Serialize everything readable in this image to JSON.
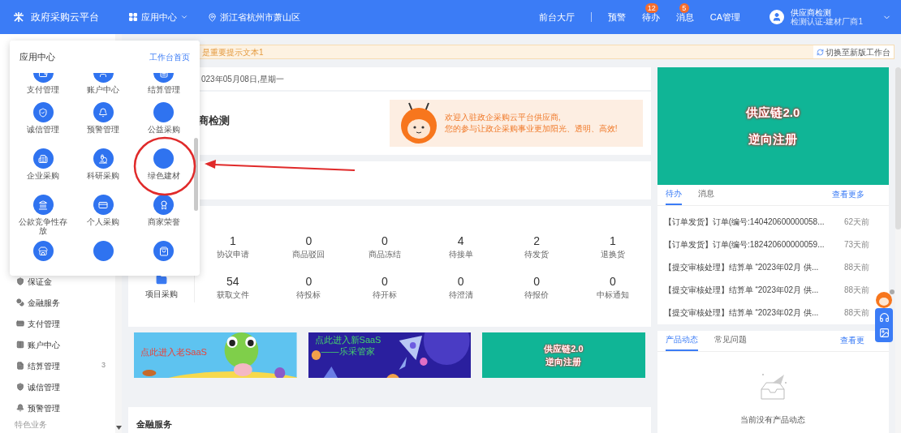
{
  "top_bar": {
    "logo": "政府采购云平台",
    "app_menu": "应用中心",
    "location": "浙江省杭州市萧山区",
    "links": [
      {
        "label": "前台大厅"
      },
      {
        "label": "预警"
      },
      {
        "label": "待办",
        "badge": "12"
      },
      {
        "label": "消息",
        "badge": "5"
      },
      {
        "label": "CA管理"
      }
    ],
    "user": {
      "name": "供应商检测",
      "role": "检测认证-建材厂商1"
    }
  },
  "sidebar": {
    "items": [
      {
        "label": "保证金"
      },
      {
        "label": "金融服务"
      },
      {
        "label": "支付管理"
      },
      {
        "label": "账户中心"
      },
      {
        "label": "结算管理",
        "badge": "3"
      },
      {
        "label": "诚信管理"
      },
      {
        "label": "预警管理"
      }
    ],
    "section": "特色业务"
  },
  "notice": {
    "text": "是重要提示文本1",
    "switch_link": "切换至新版工作台"
  },
  "date": "023年05月08日,星期一",
  "welcome": {
    "name": "商检测",
    "message_lines": [
      "欢迎入驻政企采购云平台供应商,",
      "您的参与让政企采购事业更加阳光、透明、高效!"
    ]
  },
  "stats": {
    "rows": [
      {
        "items": [
          {
            "value": "1",
            "label": "协议申请"
          },
          {
            "value": "0",
            "label": "商品驳回"
          },
          {
            "value": "0",
            "label": "商品冻结"
          },
          {
            "value": "4",
            "label": "待接单"
          },
          {
            "value": "2",
            "label": "待发货"
          },
          {
            "value": "1",
            "label": "退换货"
          }
        ]
      },
      {
        "label": "项目采购",
        "items": [
          {
            "value": "54",
            "label": "获取文件"
          },
          {
            "value": "0",
            "label": "待投标"
          },
          {
            "value": "0",
            "label": "待开标"
          },
          {
            "value": "0",
            "label": "待澄清"
          },
          {
            "value": "0",
            "label": "待报价"
          },
          {
            "value": "0",
            "label": "中标通知"
          }
        ]
      }
    ]
  },
  "banners": [
    {
      "kind": "frog",
      "lines": [
        "点此进入老SaaS"
      ]
    },
    {
      "kind": "rocket",
      "lines": [
        "点此进入新SaaS",
        "——乐采管家"
      ]
    },
    {
      "kind": "promo",
      "lines": [
        "供应链2.0",
        "逆向注册"
      ]
    }
  ],
  "finance_title": "金融服务",
  "right": {
    "promo": [
      "供应链2.0",
      "逆向注册"
    ],
    "todo_card": {
      "tabs": [
        {
          "label": "待办",
          "selected": true
        },
        {
          "label": "消息",
          "selected": false
        }
      ],
      "more": "查看更多",
      "rows": [
        {
          "text": "【订单发货】订单(编号:140420600000058...",
          "time": "62天前"
        },
        {
          "text": "【订单发货】订单(编号:182420600000059...",
          "time": "73天前"
        },
        {
          "text": "【提交审核处理】结算单 “2023年02月 供...",
          "time": "88天前"
        },
        {
          "text": "【提交审核处理】结算单 “2023年02月 供...",
          "time": "88天前"
        },
        {
          "text": "【提交审核处理】结算单 “2023年02月 供...",
          "time": "88天前"
        }
      ]
    },
    "news_card": {
      "tabs": [
        {
          "label": "产品动态",
          "selected": true
        },
        {
          "label": "常见问题",
          "selected": false
        }
      ],
      "more": "查看更",
      "empty": "当前没有产品动态"
    }
  },
  "popup": {
    "title": "应用中心",
    "link": "工作台首页",
    "apps": [
      {
        "kind": "clipped",
        "label": "支付管理"
      },
      {
        "kind": "clipped",
        "label": "账户中心"
      },
      {
        "kind": "clipped",
        "label": "结算管理"
      },
      {
        "kind": "full",
        "label": "诚信管理"
      },
      {
        "kind": "full",
        "label": "预警管理"
      },
      {
        "kind": "full",
        "label": "公益采购"
      },
      {
        "kind": "full",
        "label": "企业采购"
      },
      {
        "kind": "full",
        "label": "科研采购"
      },
      {
        "kind": "full",
        "label": "绿色建材"
      },
      {
        "kind": "full",
        "label": "公款竞争性存放"
      },
      {
        "kind": "full",
        "label": "个人采购"
      },
      {
        "kind": "full",
        "label": "商家荣誉"
      },
      {
        "kind": "icon_only"
      },
      {
        "kind": "icon_only"
      },
      {
        "kind": "icon_only"
      }
    ]
  }
}
